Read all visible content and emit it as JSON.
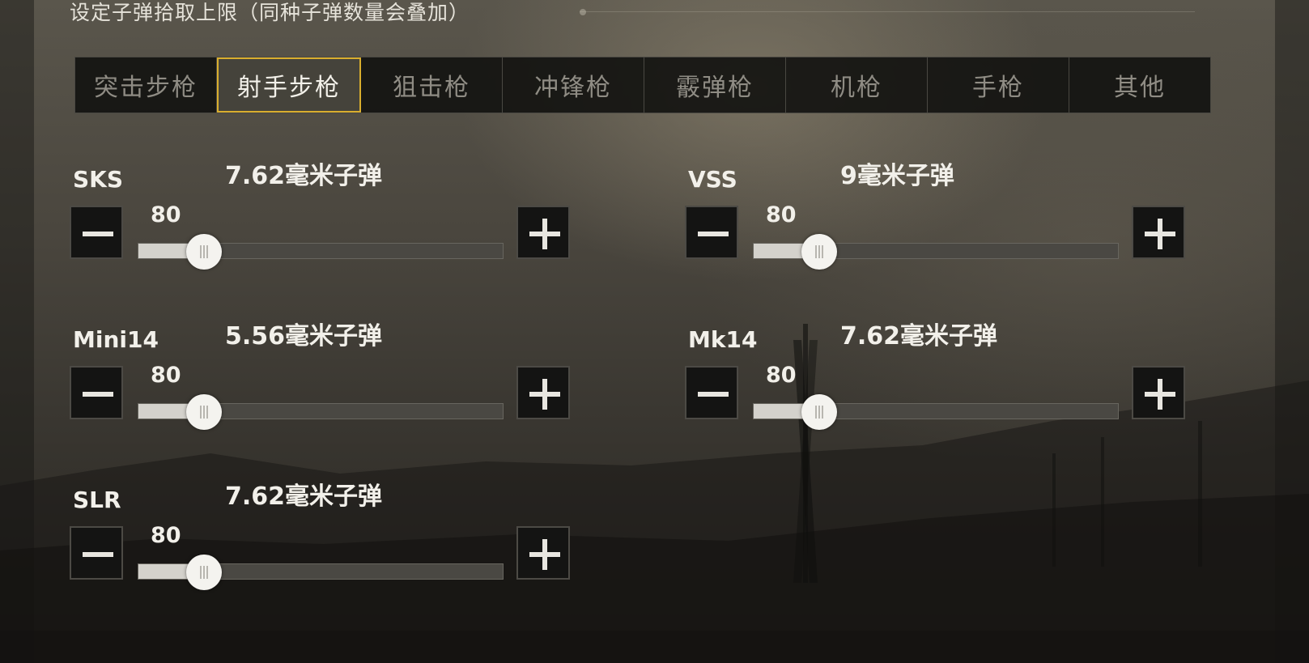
{
  "header": {
    "title": "设定子弹拾取上限（同种子弹数量会叠加）"
  },
  "tabs": [
    {
      "label": "突击步枪",
      "active": false
    },
    {
      "label": "射手步枪",
      "active": true
    },
    {
      "label": "狙击枪",
      "active": false
    },
    {
      "label": "冲锋枪",
      "active": false
    },
    {
      "label": "霰弹枪",
      "active": false
    },
    {
      "label": "机枪",
      "active": false
    },
    {
      "label": "手枪",
      "active": false
    },
    {
      "label": "其他",
      "active": false
    }
  ],
  "weapons": [
    {
      "name": "SKS",
      "ammo": "7.62毫米子弹",
      "value": "80",
      "fill_fraction": 0.18,
      "minus_icon": "minus-icon",
      "plus_icon": "plus-icon"
    },
    {
      "name": "VSS",
      "ammo": "9毫米子弹",
      "value": "80",
      "fill_fraction": 0.18,
      "minus_icon": "minus-icon",
      "plus_icon": "plus-icon"
    },
    {
      "name": "Mini14",
      "ammo": "5.56毫米子弹",
      "value": "80",
      "fill_fraction": 0.18,
      "minus_icon": "minus-icon",
      "plus_icon": "plus-icon"
    },
    {
      "name": "Mk14",
      "ammo": "7.62毫米子弹",
      "value": "80",
      "fill_fraction": 0.18,
      "minus_icon": "minus-icon",
      "plus_icon": "plus-icon"
    },
    {
      "name": "SLR",
      "ammo": "7.62毫米子弹",
      "value": "80",
      "fill_fraction": 0.18,
      "minus_icon": "minus-icon",
      "plus_icon": "plus-icon"
    }
  ],
  "colors": {
    "accent": "#d9ae2e",
    "text": "#f2f0ea",
    "inactive_tab_text": "#8f8c84"
  }
}
